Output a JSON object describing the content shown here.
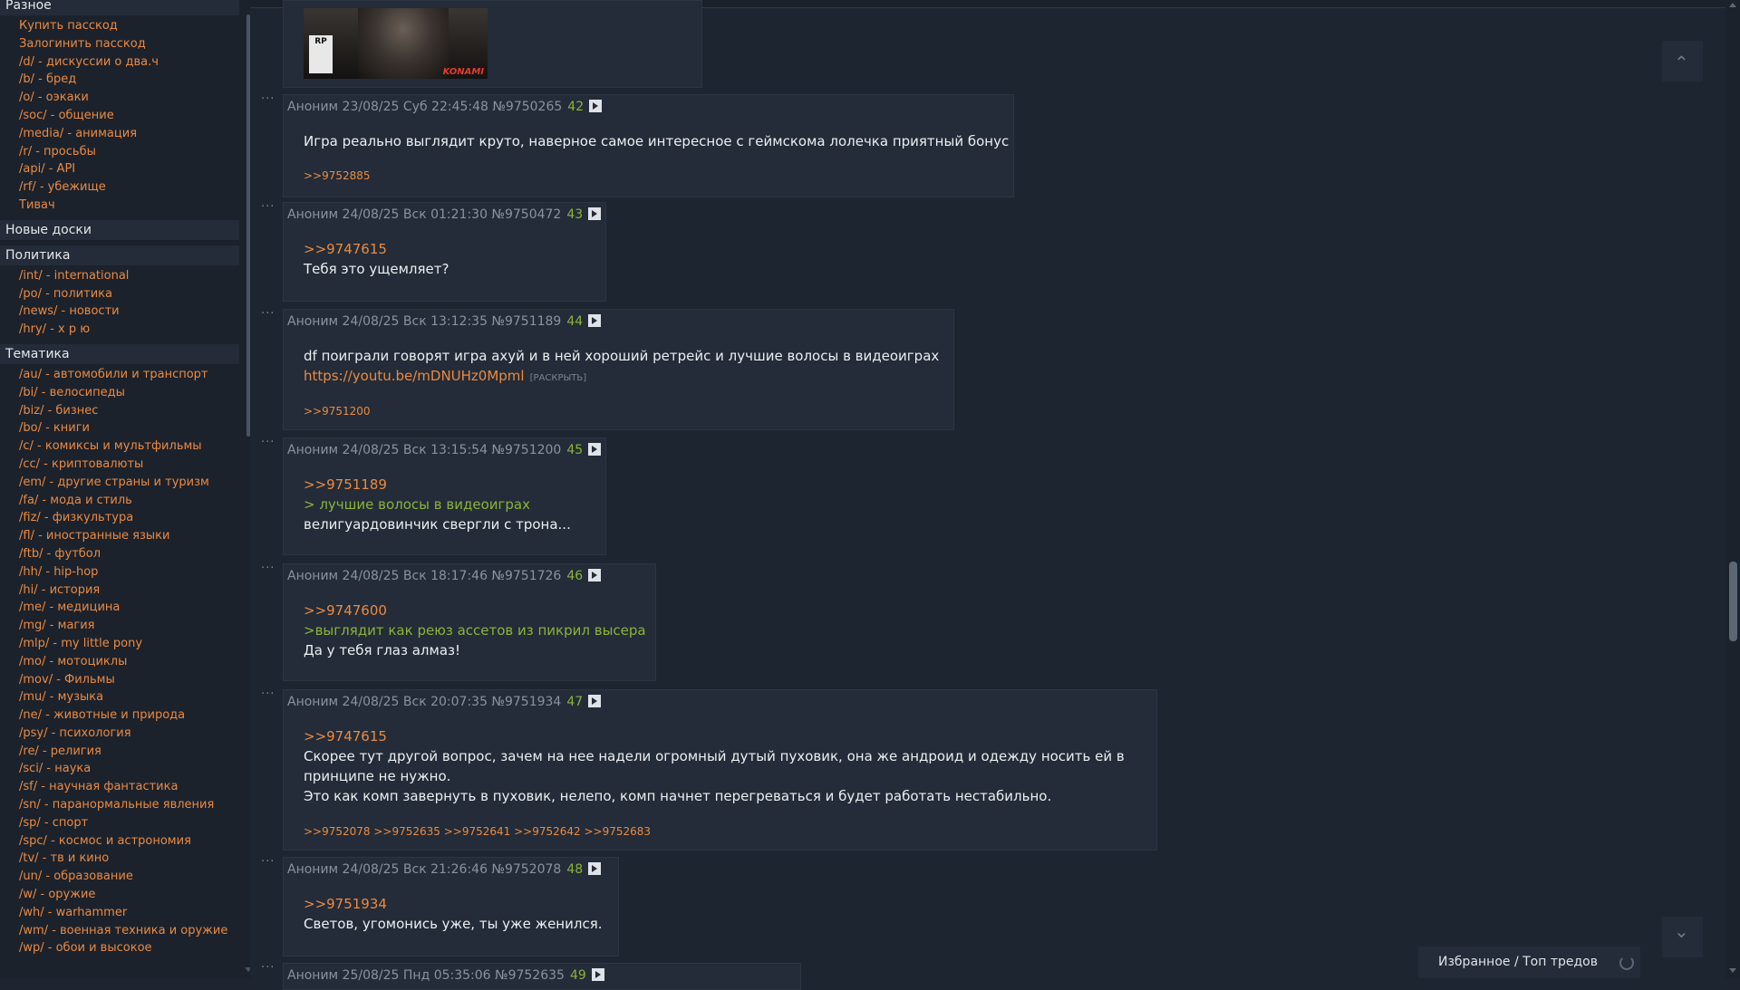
{
  "sidebar": {
    "sections": [
      {
        "title": "Разное",
        "items": [
          "Купить пасскод",
          "Залогинить пасскод",
          "/d/ - дискуссии о два.ч",
          "/b/ - бред",
          "/o/ - оэкаки",
          "/soc/ - общение",
          "/media/ - анимация",
          "/r/ - просьбы",
          "/api/ - API",
          "/rf/ - убежище",
          "Тивач"
        ]
      },
      {
        "title": "Новые доски",
        "items": []
      },
      {
        "title": "Политика",
        "items": [
          "/int/ - international",
          "/po/ - политика",
          "/news/ - новости",
          "/hry/ - х р ю"
        ]
      },
      {
        "title": "Тематика",
        "items": [
          "/au/ - автомобили и транспорт",
          "/bi/ - велосипеды",
          "/biz/ - бизнес",
          "/bo/ - книги",
          "/c/ - комиксы и мультфильмы",
          "/cc/ - криптовалюты",
          "/em/ - другие страны и туризм",
          "/fa/ - мода и стиль",
          "/fiz/ - физкультура",
          "/fl/ - иностранные языки",
          "/ftb/ - футбол",
          "/hh/ - hip-hop",
          "/hi/ - история",
          "/me/ - медицина",
          "/mg/ - магия",
          "/mlp/ - my little pony",
          "/mo/ - мотоциклы",
          "/mov/ - Фильмы",
          "/mu/ - музыка",
          "/ne/ - животные и природа",
          "/psy/ - психология",
          "/re/ - религия",
          "/sci/ - наука",
          "/sf/ - научная фантастика",
          "/sn/ - паранормальные явления",
          "/sp/ - спорт",
          "/spc/ - космос и астрономия",
          "/tv/ - тв и кино",
          "/un/ - образование",
          "/w/ - оружие",
          "/wh/ - warhammer",
          "/wm/ - военная техника и оружие",
          "/wp/ - обои и высокое"
        ]
      }
    ]
  },
  "image_post": {
    "rating": "RP",
    "brand": "KONAMI"
  },
  "posts": [
    {
      "header": "Аноним 23/08/25 Суб 22:45:48 №9750265",
      "count": "42",
      "lines": [
        {
          "t": "text",
          "v": "Игра реально выглядит круто, наверное самое интересное с геймскома лолечка приятный бонус"
        }
      ],
      "replies": ">>9752885"
    },
    {
      "header": "Аноним 24/08/25 Вск 01:21:30 №9750472",
      "count": "43",
      "lines": [
        {
          "t": "ref",
          "v": ">>9747615"
        },
        {
          "t": "text",
          "v": "Тебя это ущемляет?"
        }
      ],
      "replies": ""
    },
    {
      "header": "Аноним 24/08/25 Вск 13:12:35 №9751189",
      "count": "44",
      "lines": [
        {
          "t": "text",
          "v": "df поиграли говорят игра ахуй и в ней хороший ретрейс и лучшие волосы в видеоиграх"
        },
        {
          "t": "link",
          "v": "https://youtu.be/mDNUHz0Mpml",
          "x": "[РАСКРЫТЬ]"
        }
      ],
      "replies": ">>9751200"
    },
    {
      "header": "Аноним 24/08/25 Вск 13:15:54 №9751200",
      "count": "45",
      "lines": [
        {
          "t": "ref",
          "v": ">>9751189"
        },
        {
          "t": "quote",
          "v": "> лучшие волосы в видеоиграх"
        },
        {
          "t": "text",
          "v": "велигуардовинчик свергли с трона..."
        }
      ],
      "replies": ""
    },
    {
      "header": "Аноним 24/08/25 Вск 18:17:46 №9751726",
      "count": "46",
      "lines": [
        {
          "t": "ref",
          "v": ">>9747600"
        },
        {
          "t": "quote",
          "v": ">выглядит как реюз ассетов из пикрил высера"
        },
        {
          "t": "text",
          "v": "Да у тебя глаз алмаз!"
        }
      ],
      "replies": ""
    },
    {
      "header": "Аноним 24/08/25 Вск 20:07:35 №9751934",
      "count": "47",
      "lines": [
        {
          "t": "ref",
          "v": ">>9747615"
        },
        {
          "t": "text",
          "v": "Скорее тут другой вопрос, зачем на нее надели огромный дутый пуховик, она же андроид и одежду носить ей в"
        },
        {
          "t": "text",
          "v": "принципе не нужно."
        },
        {
          "t": "text",
          "v": "Это как комп завернуть в пуховик, нелепо, комп начнет перегреваться и будет работать нестабильно."
        }
      ],
      "replies": ">>9752078 >>9752635 >>9752641 >>9752642 >>9752683"
    },
    {
      "header": "Аноним 24/08/25 Вск 21:26:46 №9752078",
      "count": "48",
      "lines": [
        {
          "t": "ref",
          "v": ">>9751934"
        },
        {
          "t": "text",
          "v": "Светов, угомонись уже, ты уже женился."
        }
      ],
      "replies": ""
    },
    {
      "header": "Аноним 25/08/25 Пнд 05:35:06 №9752635",
      "count": "49",
      "lines": [],
      "replies": ""
    }
  ],
  "nav": {
    "up_icon": "chevron-up-icon",
    "down_icon": "chevron-down-icon",
    "up": "⌃",
    "down": "⌄"
  },
  "favorites": {
    "label": "Избранное / Топ тредов"
  }
}
